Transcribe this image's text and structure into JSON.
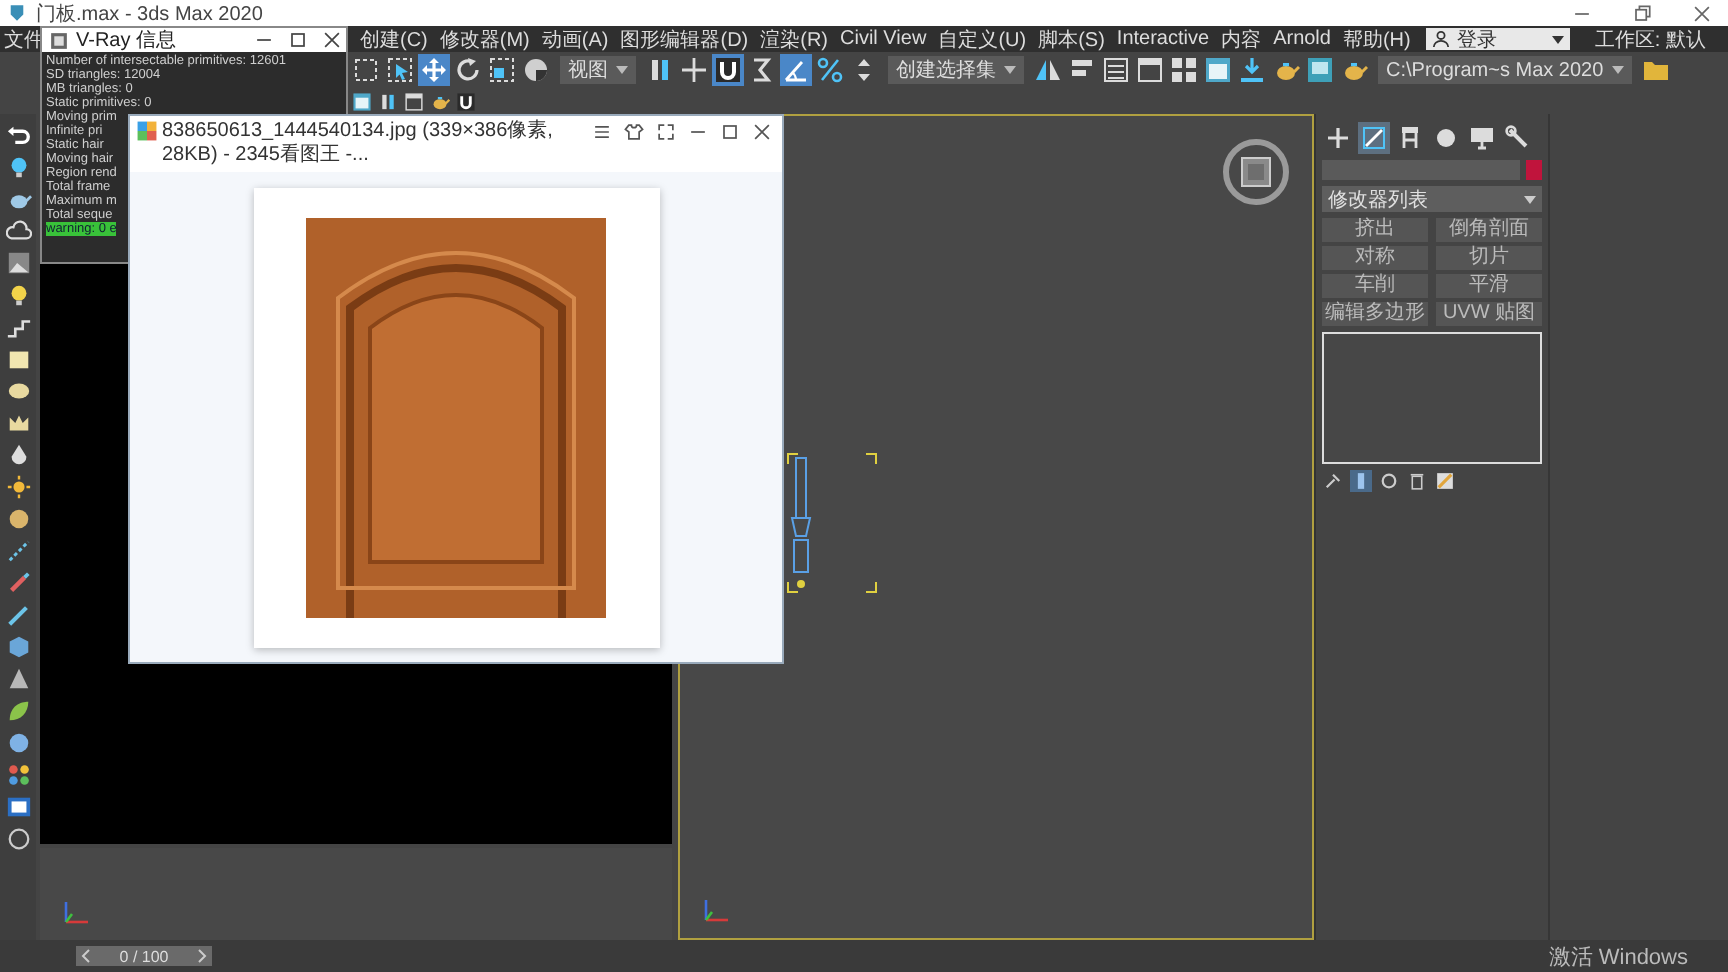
{
  "title_bar": {
    "title": "门板.max - 3ds Max 2020"
  },
  "menu_bar": {
    "items": [
      "文件",
      "创建(C)",
      "修改器(M)",
      "动画(A)",
      "图形编辑器(D)",
      "渲染(R)",
      "Civil View",
      "自定义(U)",
      "脚本(S)",
      "Interactive",
      "内容",
      "Arnold",
      "帮助(H)"
    ],
    "login": "登录",
    "workspace": "工作区: 默认"
  },
  "toolbar": {
    "items": [
      {
        "kind": "icon",
        "selected": false
      },
      {
        "kind": "icon",
        "selected": false
      },
      {
        "kind": "icon",
        "selected": true
      },
      {
        "kind": "icon",
        "selected": false
      },
      {
        "kind": "icon",
        "selected": false
      },
      {
        "kind": "icon",
        "selected": false
      },
      {
        "kind": "dropdown",
        "value": "视图"
      },
      {
        "kind": "icon",
        "selected": false
      },
      {
        "kind": "icon",
        "selected": false
      },
      {
        "kind": "icon",
        "selected": true
      },
      {
        "kind": "icon",
        "selected": false
      },
      {
        "kind": "icon",
        "selected": true
      },
      {
        "kind": "icon",
        "selected": false
      },
      {
        "kind": "icon",
        "selected": false
      },
      {
        "kind": "dropdown",
        "value": "创建选择集"
      },
      {
        "kind": "icon",
        "selected": false
      },
      {
        "kind": "icon",
        "selected": false
      },
      {
        "kind": "icon",
        "selected": false
      },
      {
        "kind": "icon",
        "selected": false
      },
      {
        "kind": "icon",
        "selected": false
      },
      {
        "kind": "icon",
        "selected": false
      },
      {
        "kind": "icon",
        "selected": false
      },
      {
        "kind": "icon",
        "selected": false
      },
      {
        "kind": "icon",
        "selected": false
      },
      {
        "kind": "icon",
        "selected": false
      },
      {
        "kind": "dropdown",
        "value": "C:\\Program~s Max 2020"
      },
      {
        "kind": "icon",
        "selected": false
      }
    ]
  },
  "vray_window": {
    "title": "V-Ray 信息",
    "lines": [
      {
        "text": "Number of intersectable primitives: 12601",
        "highlight": false
      },
      {
        "text": "SD triangles: 12004",
        "highlight": false
      },
      {
        "text": "MB triangles: 0",
        "highlight": false
      },
      {
        "text": "Static primitives: 0",
        "highlight": false
      },
      {
        "text": "Moving prim",
        "highlight": false
      },
      {
        "text": "Infinite pri",
        "highlight": false
      },
      {
        "text": "Static hair",
        "highlight": false
      },
      {
        "text": "Moving hair",
        "highlight": false
      },
      {
        "text": "Region rend",
        "highlight": false
      },
      {
        "text": "Total frame",
        "highlight": false
      },
      {
        "text": "Maximum m",
        "highlight": false
      },
      {
        "text": "Total seque",
        "highlight": false
      },
      {
        "text": "warning: 0 e",
        "highlight": true
      }
    ]
  },
  "image_viewer": {
    "title": "838650613_1444540134.jpg (339×386像素, 28KB) - 2345看图王 -..."
  },
  "command_panel": {
    "tabs": [
      {
        "selected": false
      },
      {
        "selected": true
      },
      {
        "selected": false
      },
      {
        "selected": false
      },
      {
        "selected": false
      },
      {
        "selected": false
      }
    ],
    "modifier_list": "修改器列表",
    "modifier_buttons": [
      "挤出",
      "倒角剖面",
      "对称",
      "切片",
      "车削",
      "平滑",
      "编辑多边形",
      "UVW 贴图"
    ]
  },
  "timeline": {
    "frame": "0 / 100",
    "level": 0
  },
  "activation_notice": "激活 Windows"
}
